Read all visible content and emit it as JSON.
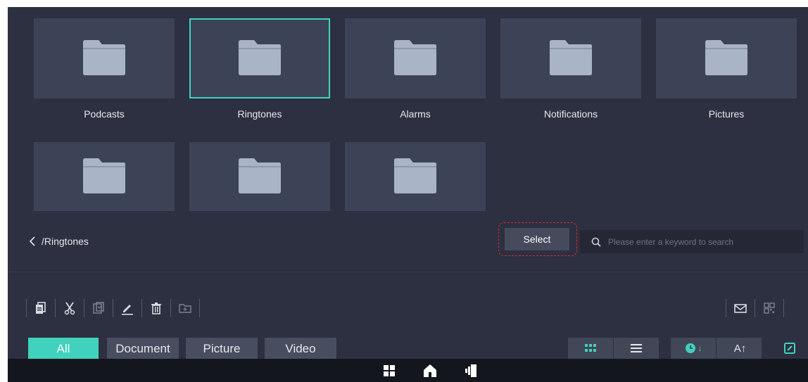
{
  "folders": [
    {
      "label": "Podcasts",
      "selected": false
    },
    {
      "label": "Ringtones",
      "selected": true
    },
    {
      "label": "Alarms",
      "selected": false
    },
    {
      "label": "Notifications",
      "selected": false
    },
    {
      "label": "Pictures",
      "selected": false
    },
    {
      "label": "",
      "selected": false
    },
    {
      "label": "",
      "selected": false
    },
    {
      "label": "",
      "selected": false
    }
  ],
  "breadcrumb": {
    "path": "/Ringtones",
    "back_icon": "chevron-left-icon"
  },
  "select_button": {
    "label": "Select"
  },
  "search": {
    "placeholder": "Please enter a keyword to search",
    "value": "",
    "icon": "search-icon"
  },
  "toolbar": {
    "left_tools": [
      "copy-icon",
      "cut-icon",
      "paste-icon",
      "rename-icon",
      "delete-icon",
      "new-folder-icon"
    ],
    "right_tools": [
      "mail-icon",
      "qr-code-icon"
    ]
  },
  "filter_tabs": [
    {
      "label": "All",
      "active": true
    },
    {
      "label": "Document",
      "active": false
    },
    {
      "label": "Picture",
      "active": false
    },
    {
      "label": "Video",
      "active": false
    }
  ],
  "view_controls": {
    "grid_view": "grid-view-icon",
    "list_view": "list-view-icon",
    "sort_time": {
      "icon": "clock-icon",
      "text": "↓"
    },
    "sort_name": {
      "icon": "sort-alpha-icon",
      "text": "A↑"
    },
    "edit": "edit-icon"
  },
  "navbar": {
    "icons": [
      "apps-icon",
      "home-icon",
      "multitask-icon"
    ]
  },
  "colors": {
    "accent": "#41d2bd",
    "background": "#2c3040",
    "tile": "#3d4356",
    "select_highlight": "#e0282e",
    "navbar": "#14161d"
  }
}
